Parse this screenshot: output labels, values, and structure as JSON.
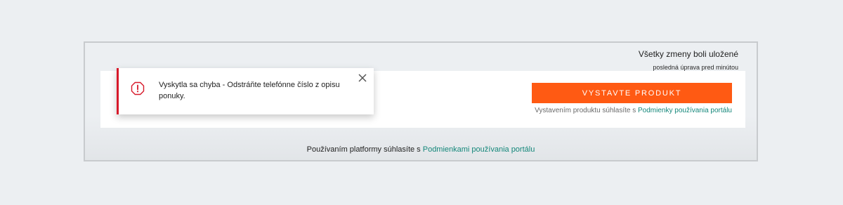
{
  "save_status": {
    "title": "Všetky zmeny boli uložené",
    "subtitle": "posledná úprava pred minútou"
  },
  "publish": {
    "button_label": "VYSTAVTE PRODUKT",
    "terms_prefix": "Vystavením produktu súhlasíte s ",
    "terms_link": "Podmienky používania portálu"
  },
  "footer": {
    "prefix": "Používaním platformy súhlasíte s ",
    "link": "Podmienkami používania portálu"
  },
  "toast": {
    "message": "Vyskytla sa chyba - Odstráňte telefónne číslo z opisu ponuky.",
    "icon": "error-octagon-icon",
    "close_icon": "close-icon"
  },
  "colors": {
    "accent": "#ff5a13",
    "link": "#14877a",
    "error": "#d7192a",
    "background": "#eceff2"
  }
}
